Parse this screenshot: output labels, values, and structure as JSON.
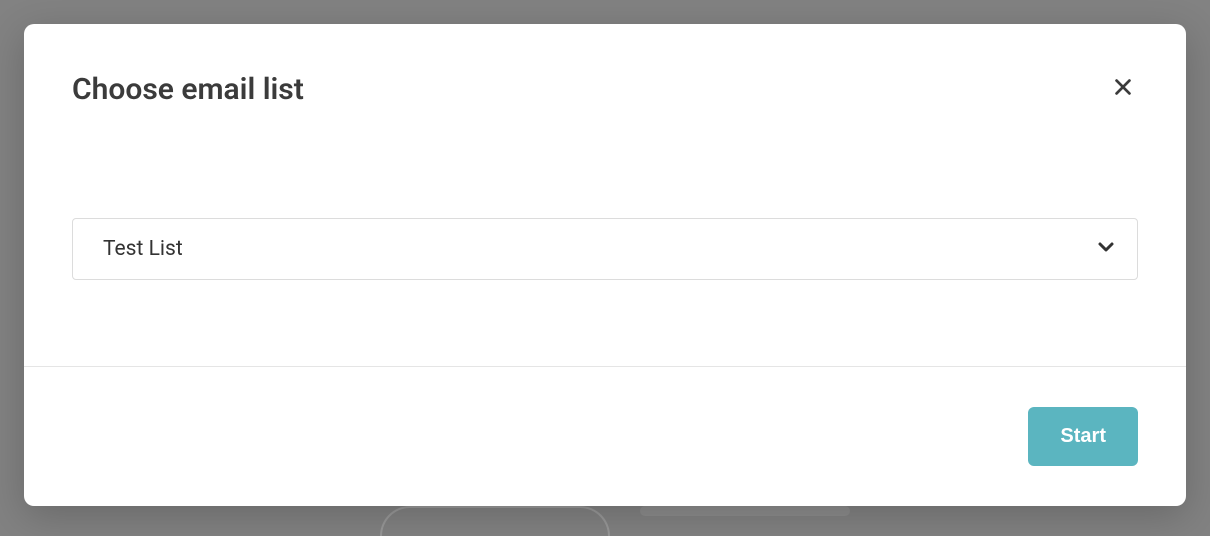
{
  "modal": {
    "title": "Choose email list",
    "select": {
      "selected": "Test List"
    },
    "footer": {
      "start_label": "Start"
    }
  }
}
